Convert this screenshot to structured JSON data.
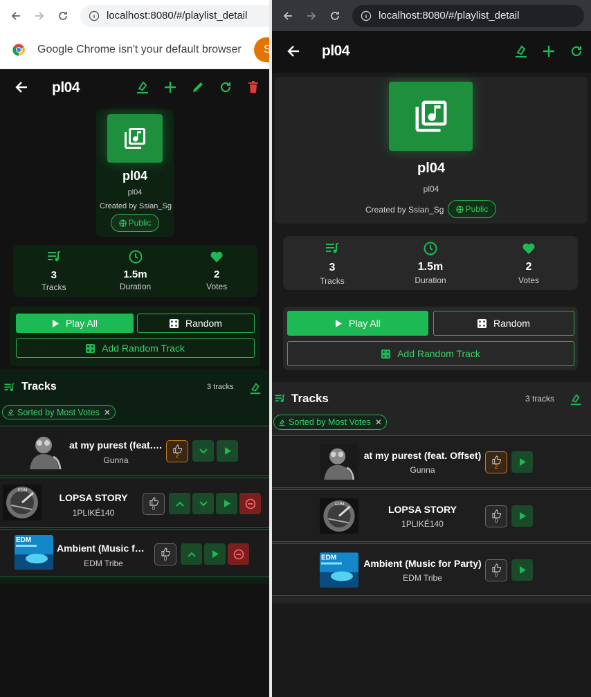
{
  "browser": {
    "url": "localhost:8080/#/playlist_detail",
    "infobar_text": "Google Chrome isn't your default browser",
    "infobar_button": "S"
  },
  "playlist": {
    "title": "pl04",
    "name": "pl04",
    "description": "pl04",
    "created_by": "Created by Ssian_Sg",
    "visibility": "Public"
  },
  "stats": [
    {
      "value": "3",
      "label": "Tracks"
    },
    {
      "value": "1.5m",
      "label": "Duration"
    },
    {
      "value": "2",
      "label": "Votes"
    }
  ],
  "actions": {
    "play_all": "Play All",
    "random": "Random",
    "add_random": "Add Random Track"
  },
  "tracks_section": {
    "title": "Tracks",
    "count": "3 tracks",
    "sort_chip": "Sorted by Most Votes"
  },
  "tracks": [
    {
      "title": "at my purest (feat. Offset)",
      "title_short": "at my purest (feat. …",
      "artist": "Gunna",
      "votes": "2"
    },
    {
      "title": "LOPSA STORY",
      "artist": "1PLIKÉ140",
      "votes": "0"
    },
    {
      "title": "Ambient (Music for Party)",
      "title_short": "Ambient (Music for…",
      "artist": "EDM Tribe",
      "votes": "0"
    }
  ],
  "colors": {
    "accent": "#1db954",
    "accent_text": "#3ad16a",
    "background": "#121212",
    "danger": "#e53935",
    "vote_hot": "#f0a030"
  }
}
